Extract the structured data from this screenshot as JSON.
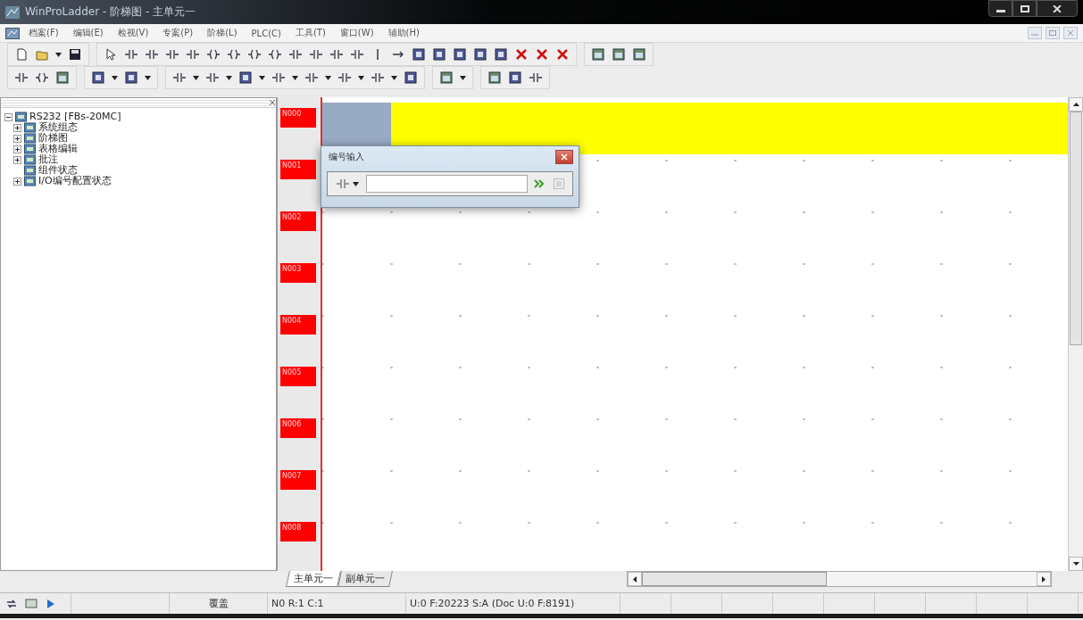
{
  "window": {
    "title": "WinProLadder - 阶梯图 - 主单元一"
  },
  "menu": [
    {
      "label": "档案(F)"
    },
    {
      "label": "编辑(E)"
    },
    {
      "label": "检视(V)"
    },
    {
      "label": "专案(P)"
    },
    {
      "label": "阶梯(L)"
    },
    {
      "label": "PLC(C)"
    },
    {
      "label": "工具(T)"
    },
    {
      "label": "窗口(W)"
    },
    {
      "label": "辅助(H)"
    }
  ],
  "tree": {
    "label": "RS232 [FBs-20MC]",
    "expanded": true,
    "children": [
      {
        "label": "系统组态",
        "expanded": false
      },
      {
        "label": "阶梯图",
        "expanded": false
      },
      {
        "label": "表格编辑",
        "expanded": false
      },
      {
        "label": "批注",
        "expanded": false
      },
      {
        "label": "组件状态"
      },
      {
        "label": "I/O编号配置状态",
        "expanded": false
      }
    ]
  },
  "ladder": {
    "rows": [
      {
        "label": "N000",
        "selected": true
      },
      {
        "label": "N001",
        "selected": false
      },
      {
        "label": "N002",
        "selected": false
      },
      {
        "label": "N003",
        "selected": false
      },
      {
        "label": "N004",
        "selected": false
      },
      {
        "label": "N005",
        "selected": false
      },
      {
        "label": "N006",
        "selected": false
      },
      {
        "label": "N007",
        "selected": false
      },
      {
        "label": "N008",
        "selected": false
      }
    ]
  },
  "dialog": {
    "title": "编号输入"
  },
  "tabs": [
    {
      "label": "主单元一",
      "selected": true
    },
    {
      "label": "副单元一",
      "selected": false
    }
  ],
  "status_bar": {
    "mode": "覆盖",
    "position": "N0 R:1 C:1",
    "memory": "U:0 F:20223 S:A (Doc U:0 F:8191)"
  }
}
